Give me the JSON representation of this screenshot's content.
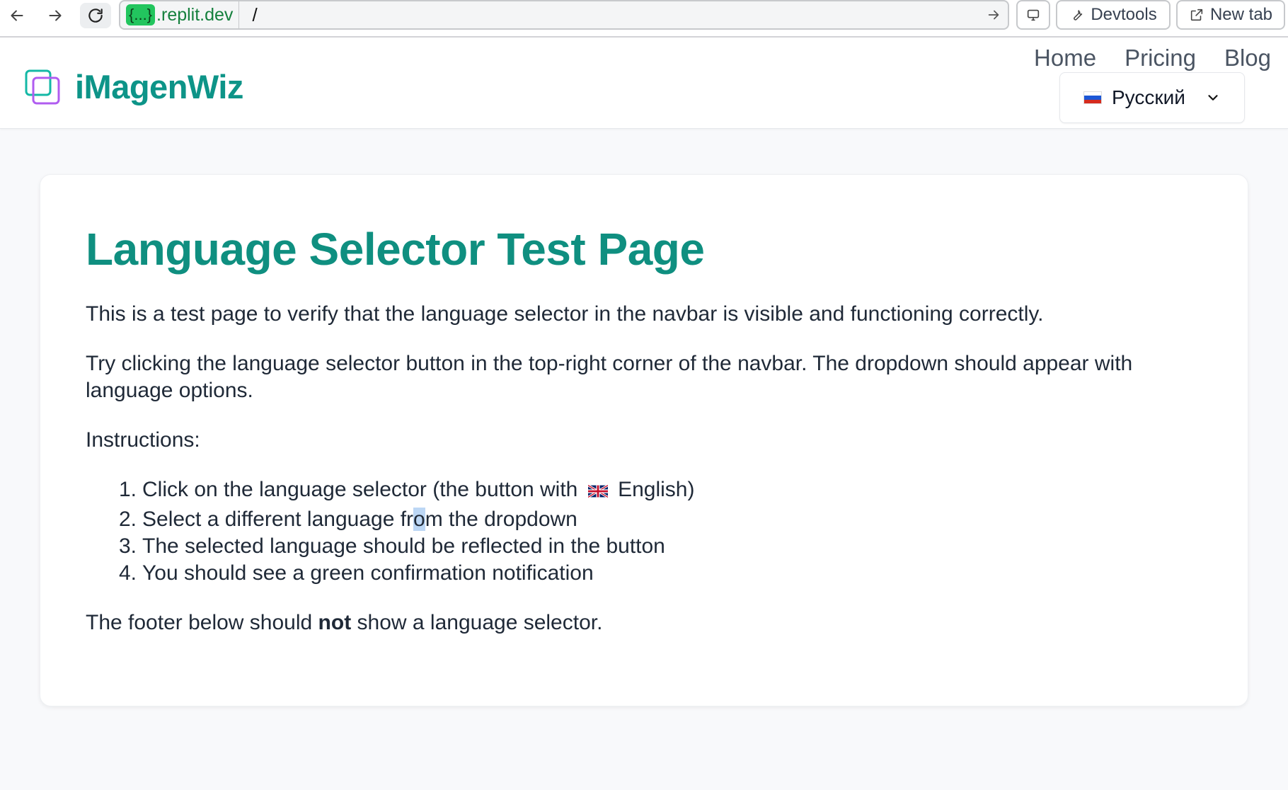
{
  "browser": {
    "domain_badge": "{...}",
    "domain": ".replit.dev",
    "path": "/",
    "devtools_label": "Devtools",
    "new_tab_label": "New tab"
  },
  "header": {
    "logo_text": "iMagenWiz",
    "nav": [
      "Home",
      "Pricing",
      "Blog"
    ],
    "language": "Русский"
  },
  "main": {
    "title": "Language Selector Test Page",
    "para1": "This is a test page to verify that the language selector in the navbar is visible and functioning correctly.",
    "para2": "Try clicking the language selector button in the top-right corner of the navbar. The dropdown should appear with language options.",
    "instructions_label": "Instructions:",
    "steps": [
      {
        "num": "1.",
        "before": "Click on the language selector (the button with",
        "after": "English)"
      },
      {
        "num": "2.",
        "before": "Select a different language fr",
        "selected": "o",
        "after": "m the dropdown"
      },
      {
        "num": "3.",
        "text": "The selected language should be reflected in the button"
      },
      {
        "num": "4.",
        "text": "You should see a green confirmation notification"
      }
    ],
    "footer_note_before": "The footer below should",
    "footer_note_bold": "not",
    "footer_note_after": "show a language selector."
  },
  "colors": {
    "brand": "#0d9488",
    "title": "#0f8f80",
    "url_green": "#15803d"
  }
}
